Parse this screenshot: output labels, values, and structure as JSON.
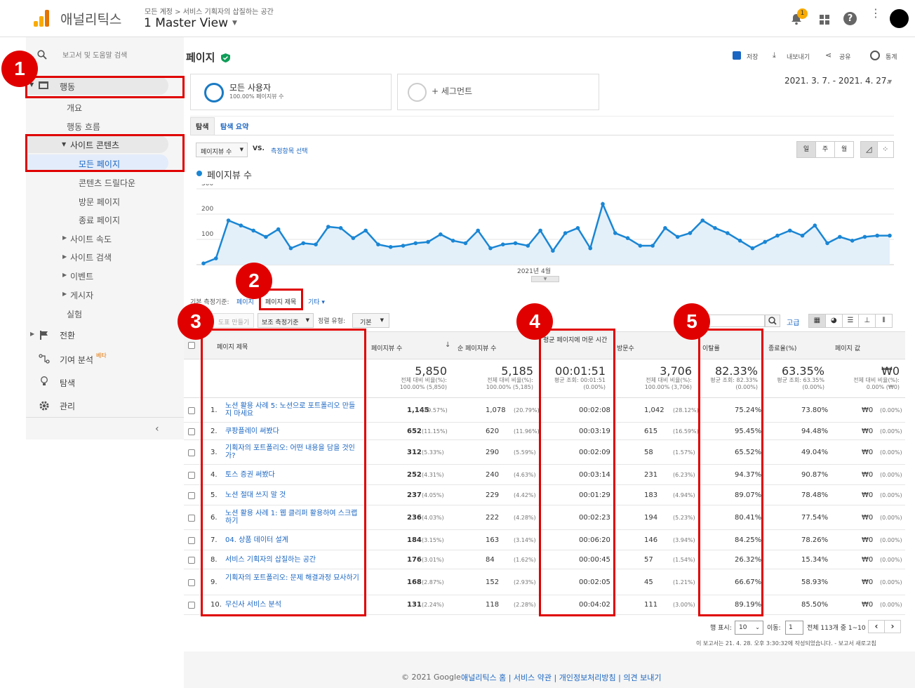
{
  "header": {
    "app_name": "애널리틱스",
    "breadcrumb": "모든 계정 > 서비스 기획자의 삽질하는 공간",
    "view": "1 Master View",
    "notif_count": "1"
  },
  "sidebar": {
    "search": "보고서 및 도움말 검색",
    "behavior": "행동",
    "overview": "개요",
    "flow": "행동 흐름",
    "site_content": "사이트 콘텐츠",
    "all_pages": "모든 페이지",
    "drilldown": "콘텐츠 드릴다운",
    "landing": "방문 페이지",
    "exit": "종료 페이지",
    "speed": "사이트 속도",
    "site_search": "사이트 검색",
    "events": "이벤트",
    "publisher": "게시자",
    "experiments": "실험",
    "conversions": "전환",
    "attribution": "기여 분석",
    "attribution_badge": "베타",
    "discover": "탐색",
    "admin": "관리"
  },
  "page": {
    "title": "페이지",
    "save": "저장",
    "export": "내보내기",
    "share": "공유",
    "insights": "통계",
    "date_range": "2021. 3. 7. - 2021. 4. 27."
  },
  "segments": {
    "all_users": "모든 사용자",
    "all_users_sub": "100.00% 페이지뷰 수",
    "add": "+ 세그먼트"
  },
  "tabs": {
    "explore": "탐색",
    "summary": "탐색 요약"
  },
  "chart_controls": {
    "metric": "페이지뷰 수",
    "vs": "VS.",
    "select": "측정항목 선택",
    "day": "일",
    "week": "주",
    "month": "월"
  },
  "chart_data": {
    "type": "line",
    "legend": "페이지뷰 수",
    "ylim": [
      0,
      300
    ],
    "yticks": [
      "300",
      "200",
      "100"
    ],
    "xlabel_mid": "2021년 4월",
    "values": [
      5,
      25,
      175,
      155,
      135,
      110,
      140,
      65,
      85,
      80,
      150,
      145,
      105,
      135,
      80,
      70,
      75,
      85,
      90,
      120,
      95,
      85,
      135,
      65,
      80,
      85,
      75,
      135,
      55,
      125,
      145,
      65,
      240,
      125,
      105,
      75,
      75,
      145,
      110,
      125,
      175,
      145,
      125,
      95,
      65,
      90,
      115,
      135,
      115,
      155,
      85,
      110,
      95,
      110,
      115,
      115
    ]
  },
  "dimension": {
    "label": "기본 측정기준:",
    "page": "페이지",
    "page_title": "페이지 제목",
    "other": "기타"
  },
  "table_controls": {
    "chart_btn": "도표 만들기",
    "secondary": "보조 측정기준",
    "sort_label": "정렬 유형:",
    "sort_value": "기본",
    "advanced": "고급"
  },
  "columns": [
    "페이지 제목",
    "페이지뷰 수",
    "순 페이지뷰 수",
    "평균 페이지에 머문 시간",
    "방문수",
    "이탈률",
    "종료율(%)",
    "페이지 값"
  ],
  "totals": {
    "pv": "5,850",
    "pv_sub": "전체 대비 비율(%):",
    "pv_sub2": "100.00% (5,850)",
    "upv": "5,185",
    "upv_sub": "전체 대비 비율(%):",
    "upv_sub2": "100.00% (5,185)",
    "time": "00:01:51",
    "time_sub": "평균 조회: 00:01:51",
    "time_sub2": "(0.00%)",
    "visits": "3,706",
    "visits_sub": "전체 대비 비율(%):",
    "visits_sub2": "100.00% (3,706)",
    "bounce": "82.33%",
    "bounce_sub": "평균 조회: 82.33%",
    "bounce_sub2": "(0.00%)",
    "exit": "63.35%",
    "exit_sub": "평균 조회: 63.35%",
    "exit_sub2": "(0.00%)",
    "value": "₩0",
    "value_sub": "전체 대비 비율(%):",
    "value_sub2": "0.00% (₩0)"
  },
  "rows": [
    {
      "n": "1.",
      "title": "노션 활용 사례 5: 노션으로 포트폴리오 만들지 마세요",
      "pv": "1,145",
      "pvp": "(19.57%)",
      "upv": "1,078",
      "upvp": "(20.79%)",
      "time": "00:02:08",
      "visits": "1,042",
      "vp": "(28.12%)",
      "bounce": "75.24%",
      "exit": "73.80%",
      "val": "₩0",
      "valp": "(0.00%)"
    },
    {
      "n": "2.",
      "title": "쿠팡플레이 써봤다",
      "pv": "652",
      "pvp": "(11.15%)",
      "upv": "620",
      "upvp": "(11.96%)",
      "time": "00:03:19",
      "visits": "615",
      "vp": "(16.59%)",
      "bounce": "95.45%",
      "exit": "94.48%",
      "val": "₩0",
      "valp": "(0.00%)"
    },
    {
      "n": "3.",
      "title": "기획자의 포트폴리오: 어떤 내용을 담을 것인가?",
      "pv": "312",
      "pvp": "(5.33%)",
      "upv": "290",
      "upvp": "(5.59%)",
      "time": "00:02:09",
      "visits": "58",
      "vp": "(1.57%)",
      "bounce": "65.52%",
      "exit": "49.04%",
      "val": "₩0",
      "valp": "(0.00%)"
    },
    {
      "n": "4.",
      "title": "토스 증권 써봤다",
      "pv": "252",
      "pvp": "(4.31%)",
      "upv": "240",
      "upvp": "(4.63%)",
      "time": "00:03:14",
      "visits": "231",
      "vp": "(6.23%)",
      "bounce": "94.37%",
      "exit": "90.87%",
      "val": "₩0",
      "valp": "(0.00%)"
    },
    {
      "n": "5.",
      "title": "노션 절대 쓰지 말 것",
      "pv": "237",
      "pvp": "(4.05%)",
      "upv": "229",
      "upvp": "(4.42%)",
      "time": "00:01:29",
      "visits": "183",
      "vp": "(4.94%)",
      "bounce": "89.07%",
      "exit": "78.48%",
      "val": "₩0",
      "valp": "(0.00%)"
    },
    {
      "n": "6.",
      "title": "노션 활용 사례 1: 웹 클리퍼 활용하여 스크랩하기",
      "pv": "236",
      "pvp": "(4.03%)",
      "upv": "222",
      "upvp": "(4.28%)",
      "time": "00:02:23",
      "visits": "194",
      "vp": "(5.23%)",
      "bounce": "80.41%",
      "exit": "77.54%",
      "val": "₩0",
      "valp": "(0.00%)"
    },
    {
      "n": "7.",
      "title": "04. 상품 데이터 설계",
      "pv": "184",
      "pvp": "(3.15%)",
      "upv": "163",
      "upvp": "(3.14%)",
      "time": "00:06:20",
      "visits": "146",
      "vp": "(3.94%)",
      "bounce": "84.25%",
      "exit": "78.26%",
      "val": "₩0",
      "valp": "(0.00%)"
    },
    {
      "n": "8.",
      "title": "서비스 기획자의 삽질하는 공간",
      "pv": "176",
      "pvp": "(3.01%)",
      "upv": "84",
      "upvp": "(1.62%)",
      "time": "00:00:45",
      "visits": "57",
      "vp": "(1.54%)",
      "bounce": "26.32%",
      "exit": "15.34%",
      "val": "₩0",
      "valp": "(0.00%)"
    },
    {
      "n": "9.",
      "title": "기획자의 포트폴리오: 문제 해결과정 묘사하기",
      "pv": "168",
      "pvp": "(2.87%)",
      "upv": "152",
      "upvp": "(2.93%)",
      "time": "00:02:05",
      "visits": "45",
      "vp": "(1.21%)",
      "bounce": "66.67%",
      "exit": "58.93%",
      "val": "₩0",
      "valp": "(0.00%)"
    },
    {
      "n": "10.",
      "title": "무신사 서비스 분석",
      "pv": "131",
      "pvp": "(2.24%)",
      "upv": "118",
      "upvp": "(2.28%)",
      "time": "00:04:02",
      "visits": "111",
      "vp": "(3.00%)",
      "bounce": "89.19%",
      "exit": "85.50%",
      "val": "₩0",
      "valp": "(0.00%)"
    }
  ],
  "pagination": {
    "rows_label": "행 표시:",
    "rows_value": "10",
    "goto_label": "이동:",
    "goto_value": "1",
    "range": "전체 113개 중 1~10"
  },
  "report_note": "이 보고서는 21. 4. 28. 오후 3:30:32에 작성되었습니다. - 보고서 새로고침",
  "footer": {
    "copyright": "© 2021 Google",
    "links": "애널리틱스 홈 | 서비스 약관 | 개인정보처리방침 | 의견 보내기"
  },
  "annotations": [
    "1",
    "2",
    "3",
    "4",
    "5"
  ]
}
